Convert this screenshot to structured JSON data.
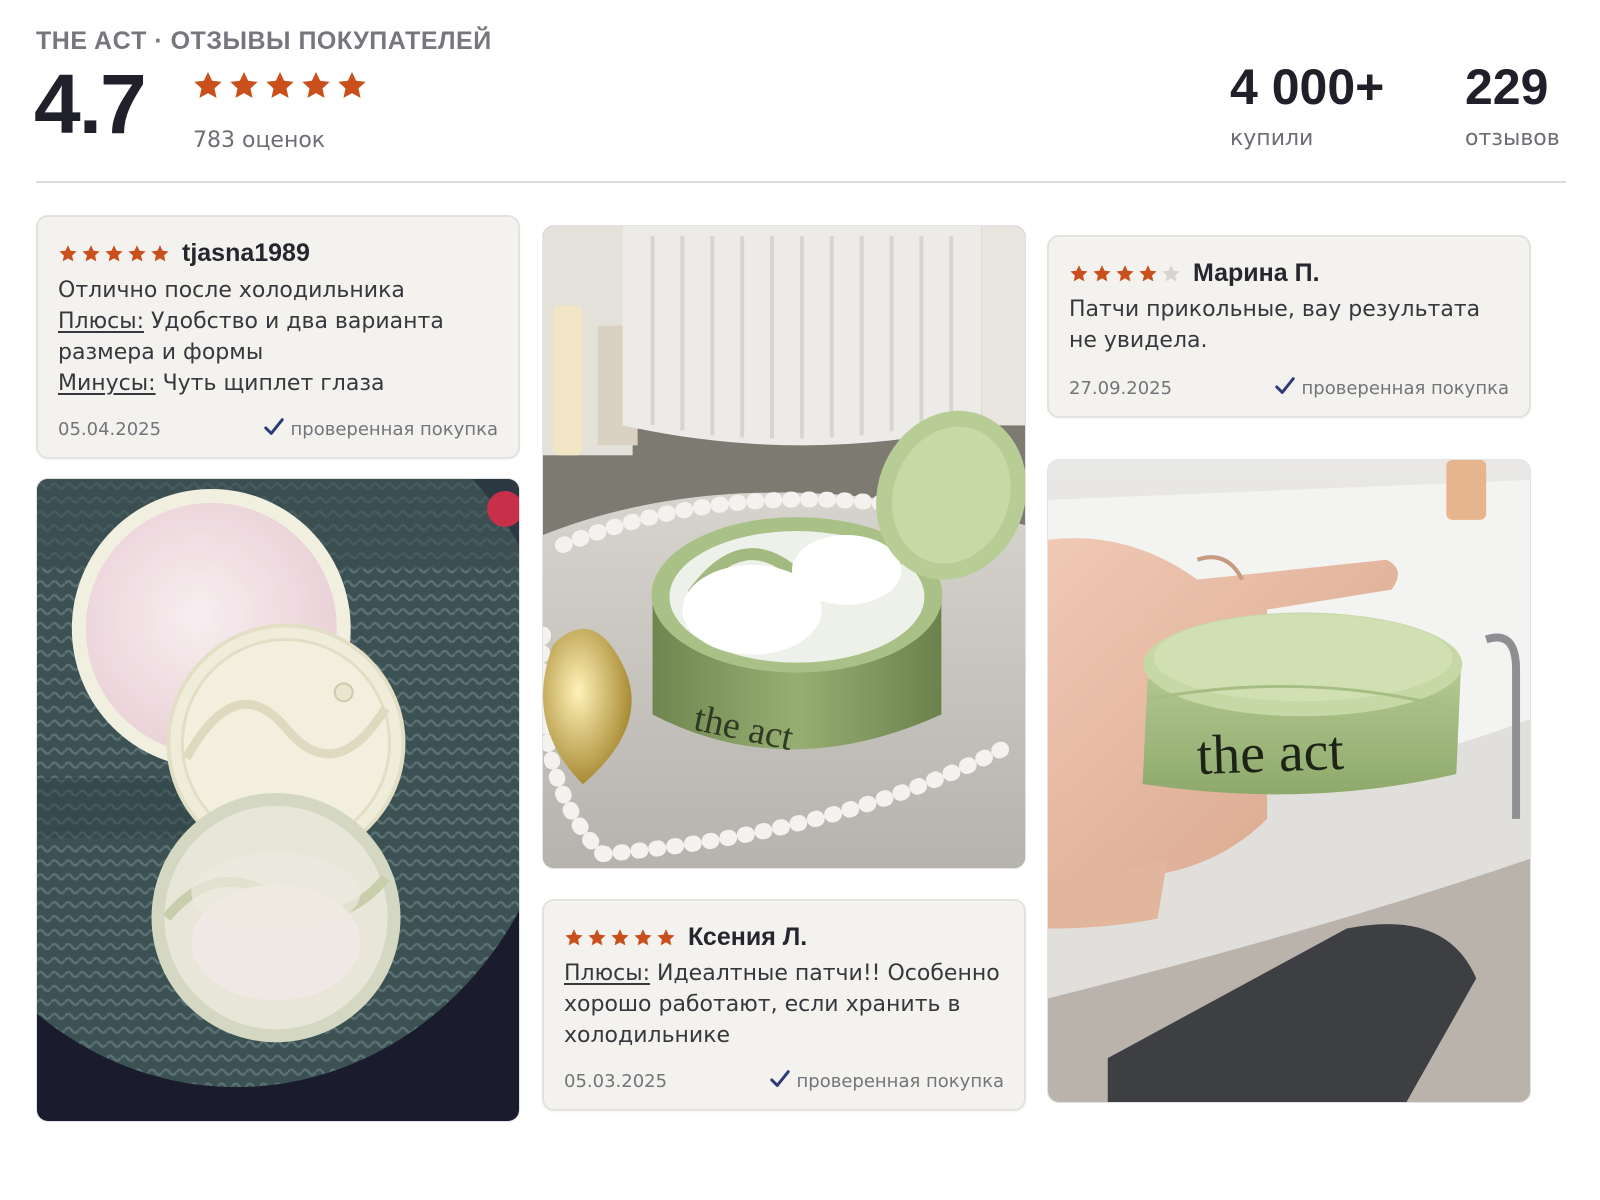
{
  "header": {
    "brand_line": "THE ACT · ОТЗЫВЫ ПОКУПАТЕЛЕЙ",
    "rating": "4.7",
    "rating_stars": 5,
    "rating_count": "783 оценок",
    "stats": [
      {
        "value": "4 000+",
        "label": "купили"
      },
      {
        "value": "229",
        "label": "отзывов"
      }
    ]
  },
  "colors": {
    "star": "#c9501c",
    "star_empty": "#d6d4d0",
    "check": "#2d3a78",
    "card_bg": "#f3f2ef"
  },
  "reviews": [
    {
      "author": "tjasna1989",
      "stars": 5,
      "text": "Отлично после холодильника",
      "pros_label": "Плюсы:",
      "pros": "Удобство и два варианта размера и формы",
      "cons_label": "Минусы:",
      "cons": "Чуть щиплет глаза",
      "date": "05.04.2025",
      "verified": "проверенная покупка"
    },
    {
      "author": "Ксения Л.",
      "stars": 5,
      "pros_label": "Плюсы:",
      "pros": "Идеалтные патчи!! Особенно хорошо работают, если хранить в холодильнике",
      "date": "05.03.2025",
      "verified": "проверенная покупка"
    },
    {
      "author": "Марина П.",
      "stars": 4,
      "text": "Патчи прикольные, вау результата не увидела.",
      "date": "27.09.2025",
      "verified": "проверенная покупка"
    }
  ],
  "photos": {
    "photo1": {
      "icon": "product-photo-open-jars"
    },
    "photo2": {
      "icon": "product-photo-jar-on-tray",
      "jar_text": "the act"
    },
    "photo3": {
      "icon": "product-photo-jar-in-hand",
      "jar_text": "the act"
    }
  }
}
